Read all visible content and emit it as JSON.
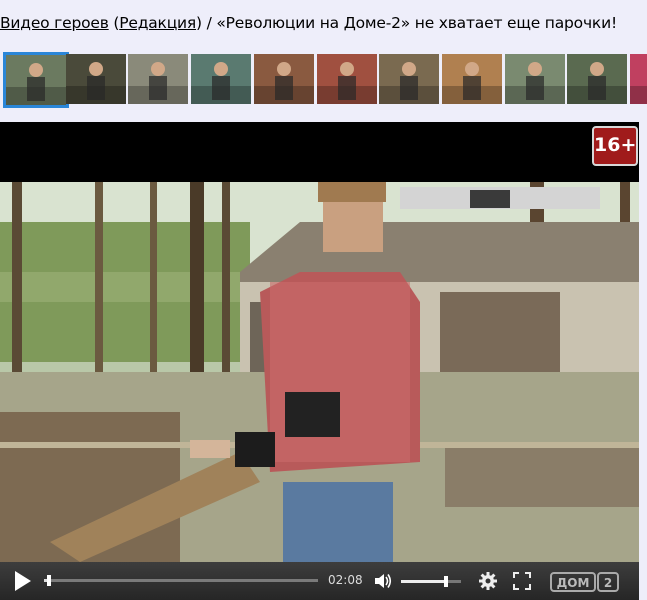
{
  "header": {
    "part1_link": "Видео героев",
    "part2_open": " (",
    "part2_link": "Редакция",
    "part2_close": ") / «Революции на Доме-2» не хватает еще парочки!"
  },
  "thumbnails": [
    {
      "label": "thumb-1",
      "active": true,
      "bg": "#6b7a60"
    },
    {
      "label": "thumb-2",
      "active": false,
      "bg": "#4a4a3a"
    },
    {
      "label": "thumb-3",
      "active": false,
      "bg": "#8a8a7a"
    },
    {
      "label": "thumb-4",
      "active": false,
      "bg": "#5a7a70"
    },
    {
      "label": "thumb-5",
      "active": false,
      "bg": "#8a5a40"
    },
    {
      "label": "thumb-6",
      "active": false,
      "bg": "#a05040"
    },
    {
      "label": "thumb-7",
      "active": false,
      "bg": "#7a6a50"
    },
    {
      "label": "thumb-8",
      "active": false,
      "bg": "#b08050"
    },
    {
      "label": "thumb-9",
      "active": false,
      "bg": "#7a8a70"
    },
    {
      "label": "thumb-10",
      "active": false,
      "bg": "#5a6a50"
    },
    {
      "label": "thumb-11",
      "active": false,
      "bg": "#c04060"
    }
  ],
  "player": {
    "age_rating": "16+",
    "time": "02:08",
    "progress": 0.01,
    "volume": 0.75,
    "brand": "ДОМ 2"
  },
  "colors": {
    "accent": "#2a86d8",
    "badge": "#a01b1b"
  }
}
